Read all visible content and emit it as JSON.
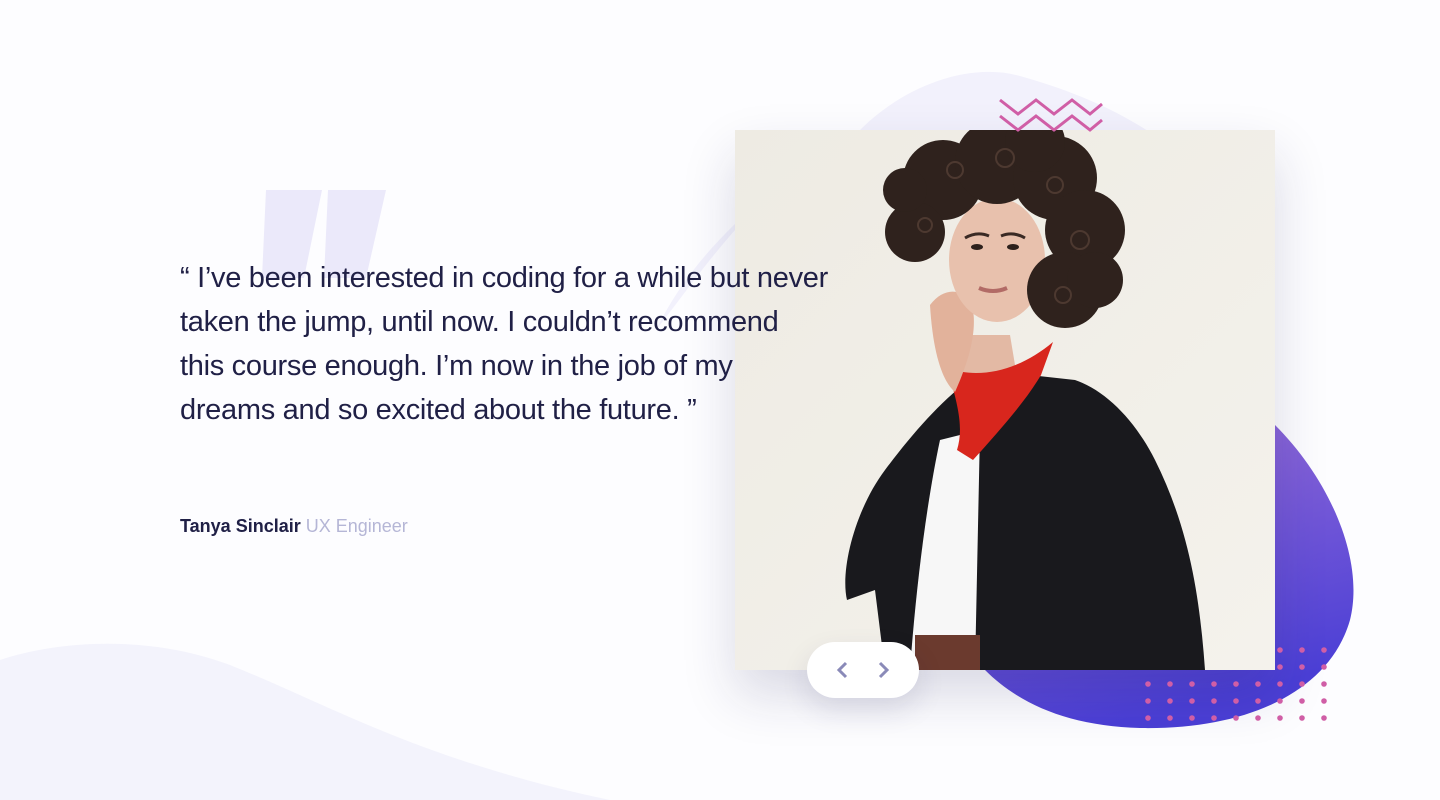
{
  "testimonial": {
    "quote": "“ I’ve been interested in coding for a while but never taken the jump, until now. I couldn’t recommend this course enough. I’m now in the job of my dreams and so excited about the future. ”",
    "author_name": "Tanya Sinclair",
    "author_role": "UX Engineer"
  },
  "navigation": {
    "prev_icon": "chevron-left-icon",
    "next_icon": "chevron-right-icon"
  },
  "colors": {
    "text_dark": "#202046",
    "text_muted": "#b5b6d6",
    "accent_purple": "#7c5bd1",
    "accent_pink": "#d05ea6",
    "bg_soft": "#f3f3fc"
  }
}
